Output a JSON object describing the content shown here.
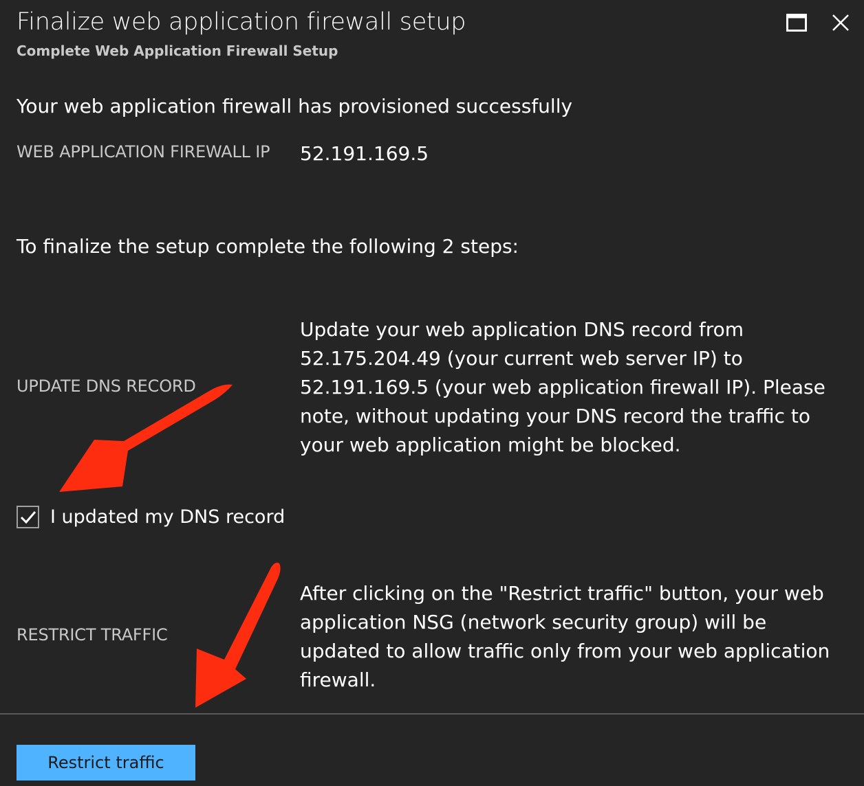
{
  "header": {
    "title": "Finalize web application firewall setup",
    "subtitle": "Complete Web Application Firewall Setup",
    "maximize_icon": "maximize-icon",
    "close_icon": "close-icon"
  },
  "status": {
    "heading": "Your web application firewall has provisioned successfully",
    "ip_label": "WEB APPLICATION FIREWALL IP",
    "ip_value": "52.191.169.5"
  },
  "steps": {
    "intro": "To finalize the setup complete the following 2 steps:",
    "dns": {
      "label": "UPDATE DNS RECORD",
      "description": "Update your web application DNS record from 52.175.204.49 (your current web server IP) to 52.191.169.5 (your web application firewall IP). Please note, without updating your DNS record the traffic to your web application might be blocked.",
      "checkbox_label": "I updated my DNS record",
      "checkbox_icon": "checkmark-icon"
    },
    "restrict": {
      "label": "RESTRICT TRAFFIC",
      "description": "After clicking on the \"Restrict traffic\" button, your web application NSG (network security group) will be updated to allow traffic only from your web application firewall."
    }
  },
  "footer": {
    "button_label": "Restrict traffic"
  },
  "colors": {
    "background": "#252526",
    "button_background": "#4fb3ff",
    "annotation_arrow": "#ff2d0f",
    "label_text": "#c8c8c8"
  }
}
